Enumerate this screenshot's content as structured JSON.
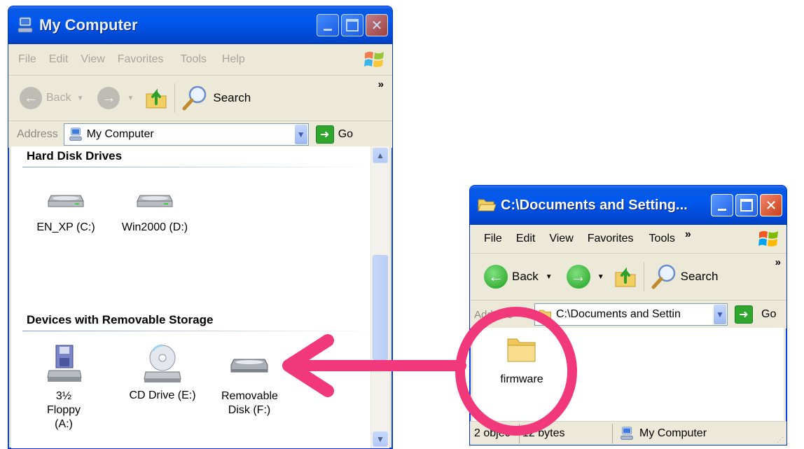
{
  "left_window": {
    "title": "My Computer",
    "menu": [
      "File",
      "Edit",
      "View",
      "Favorites",
      "Tools",
      "Help"
    ],
    "toolbar": {
      "back": "Back",
      "search": "Search",
      "chevron": "»"
    },
    "address": {
      "label": "Address",
      "value": "My Computer",
      "go": "Go"
    },
    "groups": [
      {
        "heading": "Hard Disk Drives",
        "items": [
          "EN_XP (C:)",
          "Win2000 (D:)"
        ]
      },
      {
        "heading": "Devices with Removable Storage",
        "items": [
          "3½ Floppy (A:)",
          "CD Drive (E:)",
          "Removable Disk (F:)"
        ]
      }
    ]
  },
  "right_window": {
    "title": "C:\\Documents and Setting...",
    "menu": [
      "File",
      "Edit",
      "View",
      "Favorites",
      "Tools"
    ],
    "menu_chevron": "»",
    "toolbar": {
      "back": "Back",
      "search": "Search",
      "chevron": "»"
    },
    "address": {
      "label": "Address",
      "value": "C:\\Documents and Settin",
      "go": "Go"
    },
    "folder": "firmware",
    "status": {
      "objects": "2 objec",
      "size": "12 bytes",
      "location": "My Computer"
    }
  },
  "colors": {
    "annotation": "#F0387A",
    "titlebar": "#0058EE",
    "chrome": "#ECE9D8"
  },
  "annotation": {
    "circle_target": "firmware",
    "arrow_target": "Removable Disk (F:)"
  }
}
